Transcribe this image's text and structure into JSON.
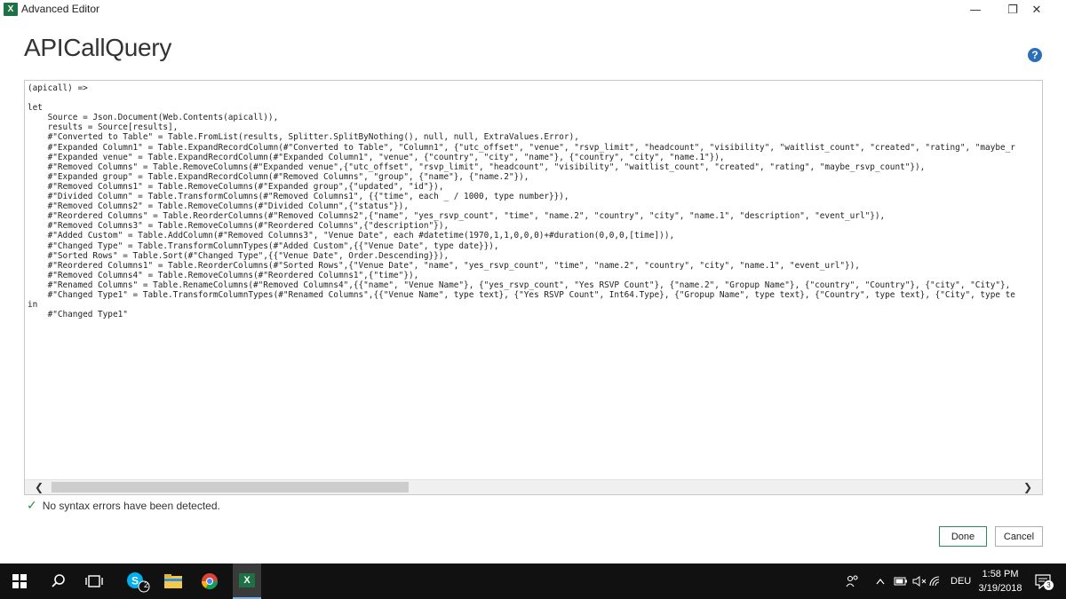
{
  "window": {
    "title": "Advanced Editor",
    "app_icon_glyph": "X",
    "minimize_glyph": "—",
    "maximize_glyph": "❐",
    "close_glyph": "✕"
  },
  "header": {
    "query_name": "APICallQuery",
    "help_glyph": "?"
  },
  "editor": {
    "lines": [
      "(apicall) =>",
      "",
      "let",
      "    Source = Json.Document(Web.Contents(apicall)),",
      "    results = Source[results],",
      "    #\"Converted to Table\" = Table.FromList(results, Splitter.SplitByNothing(), null, null, ExtraValues.Error),",
      "    #\"Expanded Column1\" = Table.ExpandRecordColumn(#\"Converted to Table\", \"Column1\", {\"utc_offset\", \"venue\", \"rsvp_limit\", \"headcount\", \"visibility\", \"waitlist_count\", \"created\", \"rating\", \"maybe_r",
      "    #\"Expanded venue\" = Table.ExpandRecordColumn(#\"Expanded Column1\", \"venue\", {\"country\", \"city\", \"name\"}, {\"country\", \"city\", \"name.1\"}),",
      "    #\"Removed Columns\" = Table.RemoveColumns(#\"Expanded venue\",{\"utc_offset\", \"rsvp_limit\", \"headcount\", \"visibility\", \"waitlist_count\", \"created\", \"rating\", \"maybe_rsvp_count\"}),",
      "    #\"Expanded group\" = Table.ExpandRecordColumn(#\"Removed Columns\", \"group\", {\"name\"}, {\"name.2\"}),",
      "    #\"Removed Columns1\" = Table.RemoveColumns(#\"Expanded group\",{\"updated\", \"id\"}),",
      "    #\"Divided Column\" = Table.TransformColumns(#\"Removed Columns1\", {{\"time\", each _ / 1000, type number}}),",
      "    #\"Removed Columns2\" = Table.RemoveColumns(#\"Divided Column\",{\"status\"}),",
      "    #\"Reordered Columns\" = Table.ReorderColumns(#\"Removed Columns2\",{\"name\", \"yes_rsvp_count\", \"time\", \"name.2\", \"country\", \"city\", \"name.1\", \"description\", \"event_url\"}),",
      "    #\"Removed Columns3\" = Table.RemoveColumns(#\"Reordered Columns\",{\"description\"}),",
      "    #\"Added Custom\" = Table.AddColumn(#\"Removed Columns3\", \"Venue Date\", each #datetime(1970,1,1,0,0,0)+#duration(0,0,0,[time])),",
      "    #\"Changed Type\" = Table.TransformColumnTypes(#\"Added Custom\",{{\"Venue Date\", type date}}),",
      "    #\"Sorted Rows\" = Table.Sort(#\"Changed Type\",{{\"Venue Date\", Order.Descending}}),",
      "    #\"Reordered Columns1\" = Table.ReorderColumns(#\"Sorted Rows\",{\"Venue Date\", \"name\", \"yes_rsvp_count\", \"time\", \"name.2\", \"country\", \"city\", \"name.1\", \"event_url\"}),",
      "    #\"Removed Columns4\" = Table.RemoveColumns(#\"Reordered Columns1\",{\"time\"}),",
      "    #\"Renamed Columns\" = Table.RenameColumns(#\"Removed Columns4\",{{\"name\", \"Venue Name\"}, {\"yes_rsvp_count\", \"Yes RSVP Count\"}, {\"name.2\", \"Gropup Name\"}, {\"country\", \"Country\"}, {\"city\", \"City\"},",
      "    #\"Changed Type1\" = Table.TransformColumnTypes(#\"Renamed Columns\",{{\"Venue Name\", type text}, {\"Yes RSVP Count\", Int64.Type}, {\"Gropup Name\", type text}, {\"Country\", type text}, {\"City\", type te",
      "in",
      "    #\"Changed Type1\""
    ],
    "scroll_left_glyph": "❮",
    "scroll_right_glyph": "❯"
  },
  "status": {
    "check_glyph": "✓",
    "message": "No syntax errors have been detected."
  },
  "buttons": {
    "done": "Done",
    "cancel": "Cancel"
  },
  "taskbar": {
    "skype_badge": "2",
    "excel_label": "X",
    "language": "DEU",
    "time": "1:58 PM",
    "date": "3/19/2018",
    "notification_count": "3"
  },
  "colors": {
    "excel_green": "#1e7145",
    "help_blue": "#2a6fb8",
    "check_green": "#2e8b57",
    "taskbar_bg": "#111111"
  }
}
